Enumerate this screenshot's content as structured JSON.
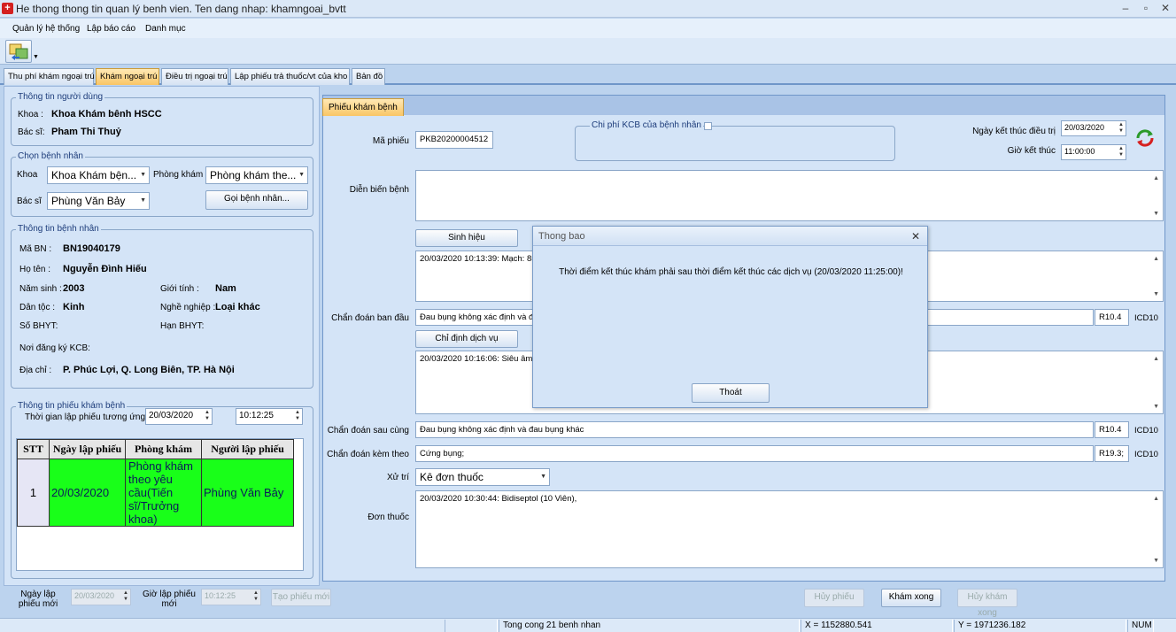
{
  "window": {
    "title": "He thong thong tin quan lý benh vien. Ten dang nhap: khamngoai_bvtt"
  },
  "menu": [
    "Quản lý hệ thống",
    "Lập báo cáo",
    "Danh mục"
  ],
  "tabs": [
    "Thu phí khám ngoại trú",
    "Khám ngoại trú",
    "Điều trị ngoại trú",
    "Lập phiếu trả thuốc/vt của kho",
    "Bản đồ"
  ],
  "user_info": {
    "group": "Thông tin người dùng",
    "khoa_label": "Khoa :",
    "khoa": "Khoa Khám bênh  HSCC",
    "bacsi_label": "Bác sĩ:",
    "bacsi": "Pham Thi Thuỷ"
  },
  "select_patient": {
    "group": "Chọn bệnh nhân",
    "khoa_label": "Khoa",
    "khoa": "Khoa Khám bện...",
    "phong_label": "Phòng khám",
    "phong": "Phòng khám the...",
    "bacsi_label": "Bác sĩ",
    "bacsi": "Phùng Văn Bảy",
    "call_btn": "Gọi bệnh nhân..."
  },
  "patient_info": {
    "group": "Thông tin bệnh nhân",
    "mabn_label": "Mã BN :",
    "mabn": "BN19040179",
    "hoten_label": "Họ tên :",
    "hoten": "Nguyễn Đình Hiếu",
    "namsinh_label": "Năm sinh :",
    "namsinh": "2003",
    "gioitinh_label": "Giới tính :",
    "gioitinh": "Nam",
    "dantoc_label": "Dân tộc :",
    "dantoc": "Kinh",
    "nghe_label": "Nghề nghiệp :",
    "nghe": "Loại khác",
    "sobhyt_label": "Số BHYT:",
    "hanbhyt_label": "Hạn BHYT:",
    "noidk_label": "Nơi đăng ký KCB:",
    "diachi_label": "Địa chỉ :",
    "diachi": "P. Phúc Lợi, Q. Long Biên, TP. Hà Nội"
  },
  "exam_sheet_info": {
    "group": "Thông tin phiếu khám bệnh",
    "time_label": "Thời gian lập phiếu tương ứng",
    "date": "20/03/2020",
    "time": "10:12:25",
    "columns": [
      "STT",
      "Ngày lập phiếu",
      "Phòng khám",
      "Người lập phiếu"
    ],
    "rows": [
      {
        "stt": "1",
        "ngay": "20/03/2020",
        "phong": "Phòng khám theo yêu cầu(Tiến sĩ/Trưởng khoa)",
        "nguoi": "Phùng Văn Bảy"
      }
    ]
  },
  "new_sheet": {
    "date_label": "Ngày lập phiếu mới",
    "date": "20/03/2020",
    "time_label": "Giờ lập phiếu mới",
    "time": "10:12:25",
    "btn": "Tạo phiếu mới"
  },
  "form": {
    "tab": "Phiếu khám bệnh",
    "maphieu_label": "Mã phiếu",
    "maphieu": "PKB20200004512",
    "chiphi_label": "Chi phí KCB của bệnh nhân",
    "ngaykt_label": "Ngày kết thúc điều trị",
    "ngaykt": "20/03/2020",
    "giokt_label": "Giờ kết thúc",
    "giokt": "11:00:00",
    "dienbien_label": "Diễn biến bệnh",
    "sinhhieu_btn": "Sinh hiệu",
    "sinhhieu_text": "20/03/2020 10:13:39: Mạch: 85",
    "cdbandau_label": "Chẩn đoán ban đầu",
    "cdbandau": "Đau bụng không xác định và đ",
    "cdbandau_code": "R10.4",
    "chidinh_btn": "Chỉ định dịch vụ",
    "chidinh_text": "20/03/2020 10:16:06: Siêu âm",
    "cdsaucung_label": "Chẩn đoán sau cùng",
    "cdsaucung": "Đau bụng không xác định và đau bụng khác",
    "cdsaucung_code": "R10.4",
    "cdkemtheo_label": "Chẩn đoán kèm theo",
    "cdkemtheo": "Cứng bụng;",
    "cdkemtheo_code": "R19.3;",
    "icd": "ICD10",
    "xutri_label": "Xử trí",
    "xutri": "Kê đơn thuốc",
    "donthuoc_label": "Đơn thuốc",
    "donthuoc": "20/03/2020 10:30:44:  Bidiseptol (10 Viên),",
    "huyphieu_btn": "Hủy phiếu",
    "khamxong_btn": "Khám xong",
    "huykhamxong_btn": "Hủy khám xong"
  },
  "dialog": {
    "title": "Thong bao",
    "message": "Thời điểm kết thúc khám phải sau thời điểm kết thúc các dịch vụ (20/03/2020 11:25:00)!",
    "btn": "Thoát"
  },
  "status": {
    "count": "Tong cong 21 benh nhan",
    "x": "X = 1152880.541",
    "y": "Y = 1971236.182",
    "num": "NUM"
  }
}
